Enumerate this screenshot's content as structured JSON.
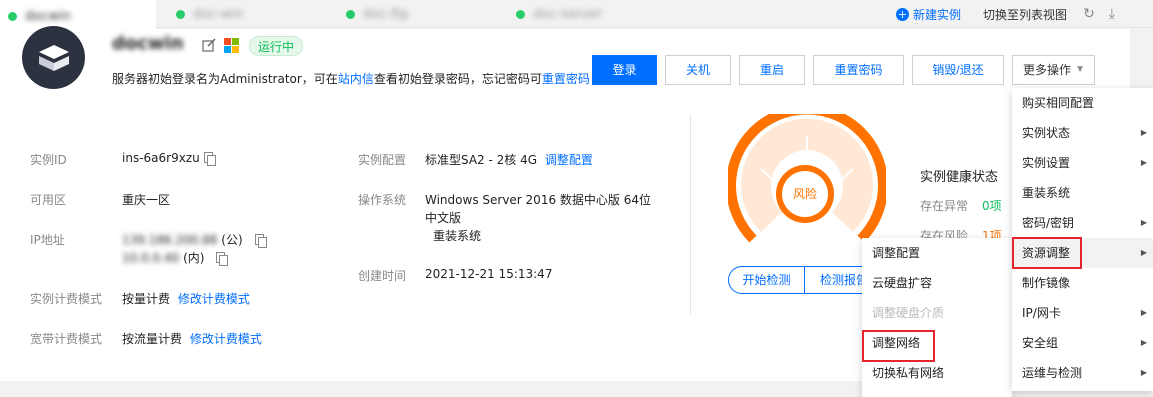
{
  "tabs": [
    {
      "label": "docwin",
      "active": true
    },
    {
      "label": "doc-win",
      "active": false
    },
    {
      "label": "doc-ftp",
      "active": false
    },
    {
      "label": "doc-server",
      "active": false
    }
  ],
  "toolbar": {
    "new_instance": "新建实例",
    "switch_list": "切换至列表视图"
  },
  "instance": {
    "name": "docwin",
    "status": "运行中",
    "notice_prefix": "服务器初始登录名为Administrator，可在",
    "notice_link1": "站内信",
    "notice_mid": "查看初始登录密码，忘记密码可",
    "notice_link2": "重置密码"
  },
  "actions": {
    "login": "登录",
    "shutdown": "关机",
    "restart": "重启",
    "reset_password": "重置密码",
    "destroy": "销毁/退还",
    "more": "更多操作"
  },
  "details": {
    "instance_id_label": "实例ID",
    "instance_id": "ins-6a6r9xzu",
    "zone_label": "可用区",
    "zone": "重庆一区",
    "ip_label": "IP地址",
    "ip_public": "139.186.200.88",
    "ip_public_tag": "(公)",
    "ip_private": "10.0.0.40",
    "ip_private_tag": "(内)",
    "billing_label": "实例计费模式",
    "billing": "按量计费",
    "billing_link": "修改计费模式",
    "bandwidth_label": "宽带计费模式",
    "bandwidth": "按流量计费",
    "bandwidth_link": "修改计费模式",
    "config_label": "实例配置",
    "config": "标准型SA2 - 2核 4G",
    "config_link": "调整配置",
    "os_label": "操作系统",
    "os_line1": "Windows Server 2016 数据中心版 64位",
    "os_line2": "中文版",
    "os_link": "重装系统",
    "created_label": "创建时间",
    "created": "2021-12-21 15:13:47"
  },
  "health": {
    "risk": "风险",
    "title": "实例健康状态",
    "abnormal_label": "存在异常",
    "abnormal_count": "0项",
    "risk_label": "存在风险",
    "risk_count": "1项",
    "start_check": "开始检测",
    "report": "检测报告",
    "colors": {
      "risk": "#ff7200",
      "ok": "#0abf5b"
    }
  },
  "more_menu": [
    {
      "label": "购买相同配置",
      "submenu": false
    },
    {
      "label": "实例状态",
      "submenu": true
    },
    {
      "label": "实例设置",
      "submenu": true
    },
    {
      "label": "重装系统",
      "submenu": false
    },
    {
      "label": "密码/密钥",
      "submenu": true
    },
    {
      "label": "资源调整",
      "submenu": true
    },
    {
      "label": "制作镜像",
      "submenu": false
    },
    {
      "label": "IP/网卡",
      "submenu": true
    },
    {
      "label": "安全组",
      "submenu": true
    },
    {
      "label": "运维与检测",
      "submenu": true
    }
  ],
  "sub_menu": [
    {
      "label": "调整配置",
      "disabled": false
    },
    {
      "label": "云硬盘扩容",
      "disabled": false
    },
    {
      "label": "调整硬盘介质",
      "disabled": true
    },
    {
      "label": "调整网络",
      "disabled": false
    },
    {
      "label": "切换私有网络",
      "disabled": false
    }
  ]
}
